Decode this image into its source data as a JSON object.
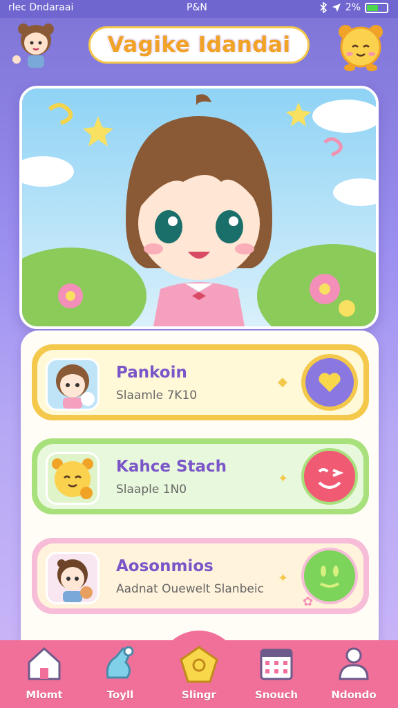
{
  "status_bar": {
    "left_text": "rlec Dndaraai",
    "time": "P&N",
    "battery": "2%"
  },
  "header": {
    "title": "Vagike Idandai"
  },
  "cards": [
    {
      "name": "Pankoin",
      "subtitle": "Slaamle 7K10",
      "accent": "#f4c84a",
      "button": "heart-icon"
    },
    {
      "name": "Kahce Stach",
      "subtitle": "Slaaple 1N0",
      "accent": "#a8e07c",
      "button": "wink-face-icon"
    },
    {
      "name": "Aosonmios",
      "subtitle": "Aadnat Ouewelt Slanbeic",
      "accent": "#f6bcd8",
      "button": "smile-face-icon"
    }
  ],
  "nav": {
    "items": [
      {
        "label": "Mlomt",
        "icon": "home-icon"
      },
      {
        "label": "Toyll",
        "icon": "toy-icon"
      },
      {
        "label": "Slingr",
        "icon": "pentagon-icon"
      },
      {
        "label": "Snouch",
        "icon": "calendar-icon"
      },
      {
        "label": "Ndondo",
        "icon": "person-icon"
      }
    ]
  }
}
